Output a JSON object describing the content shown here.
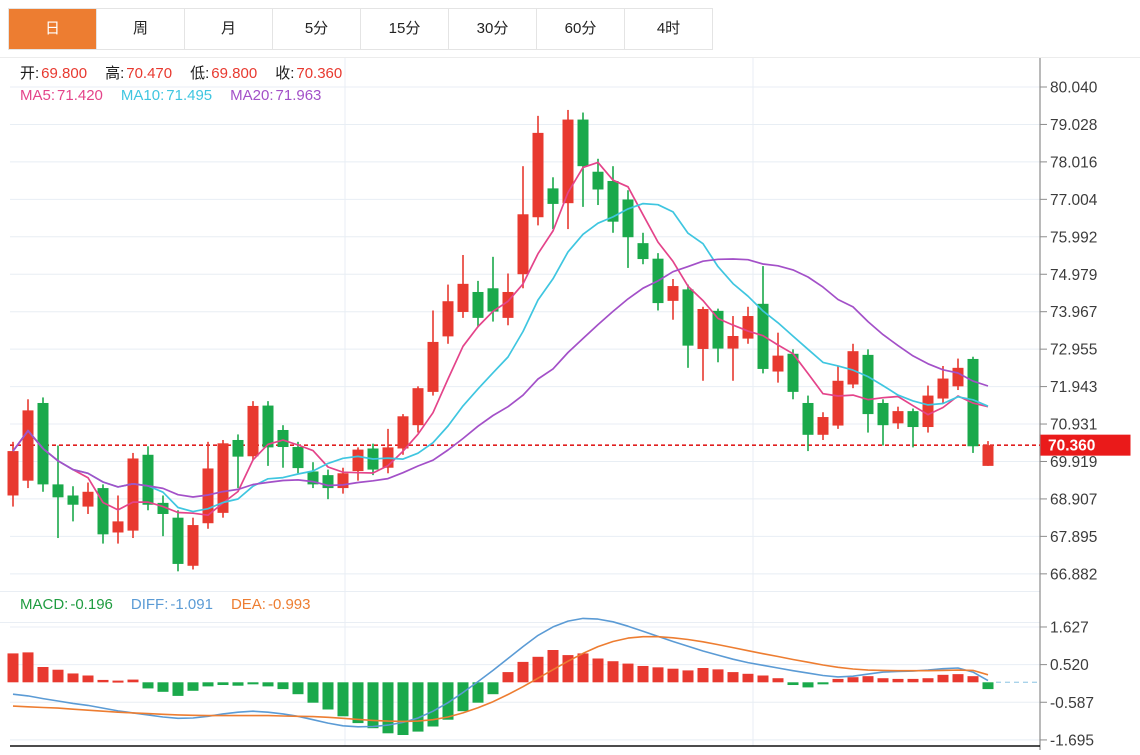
{
  "tabs": {
    "active_color": "#ed7d31",
    "items": [
      {
        "label": "日",
        "name": "day",
        "active": true
      },
      {
        "label": "周",
        "name": "week",
        "active": false
      },
      {
        "label": "月",
        "name": "month",
        "active": false
      },
      {
        "label": "5分",
        "name": "5min",
        "active": false
      },
      {
        "label": "15分",
        "name": "15min",
        "active": false
      },
      {
        "label": "30分",
        "name": "30min",
        "active": false
      },
      {
        "label": "60分",
        "name": "60min",
        "active": false
      },
      {
        "label": "4时",
        "name": "4hour",
        "active": false
      }
    ]
  },
  "info": {
    "ohlc": [
      {
        "label": "开:",
        "value": "69.800",
        "value_color": "#e8392f"
      },
      {
        "label": "高:",
        "value": "70.470",
        "value_color": "#e8392f"
      },
      {
        "label": "低:",
        "value": "69.800",
        "value_color": "#e8392f"
      },
      {
        "label": "收:",
        "value": "70.360",
        "value_color": "#e8392f"
      }
    ],
    "ma": [
      {
        "label": "MA5:",
        "value": "71.420",
        "color": "#e4448a"
      },
      {
        "label": "MA10:",
        "value": "71.495",
        "color": "#3fc6e0"
      },
      {
        "label": "MA20:",
        "value": "71.963",
        "color": "#a350c8"
      }
    ],
    "macd": [
      {
        "label": "MACD:",
        "value": "-0.196",
        "color": "#1f9c40"
      },
      {
        "label": "DIFF:",
        "value": "-1.091",
        "color": "#5b9bd5"
      },
      {
        "label": "DEA:",
        "value": "-0.993",
        "color": "#ed7d31"
      }
    ]
  },
  "chart_data": [
    {
      "type": "candlestick",
      "timeframe": "日",
      "up_color": "#e8392f",
      "down_color": "#1aa94b",
      "grid": true,
      "axis_side": "right",
      "y_ticks": [
        "80.040",
        "79.028",
        "78.016",
        "77.004",
        "75.992",
        "74.979",
        "73.967",
        "72.955",
        "71.943",
        "70.931",
        "69.919",
        "68.907",
        "67.895",
        "66.882"
      ],
      "ylim": [
        66.5,
        80.3
      ],
      "current_price": 70.36,
      "current_price_label": "70.360",
      "current_price_tag_color": "#ea1a1a",
      "overlays": [
        {
          "name": "MA5",
          "period": 5,
          "color": "#e4448a",
          "value_label": "71.420"
        },
        {
          "name": "MA10",
          "period": 10,
          "color": "#3fc6e0",
          "value_label": "71.495"
        },
        {
          "name": "MA20",
          "period": 20,
          "color": "#a350c8",
          "value_label": "71.963"
        }
      ],
      "ohlc_last": {
        "open": 69.8,
        "high": 70.47,
        "low": 69.8,
        "close": 70.36
      },
      "candles": [
        [
          69.0,
          70.45,
          68.7,
          70.2
        ],
        [
          69.4,
          71.6,
          69.2,
          71.3
        ],
        [
          71.5,
          71.65,
          69.1,
          69.3
        ],
        [
          69.3,
          70.35,
          67.85,
          68.95
        ],
        [
          69.0,
          69.25,
          68.3,
          68.75
        ],
        [
          68.7,
          69.35,
          68.5,
          69.1
        ],
        [
          69.2,
          69.3,
          67.7,
          67.95
        ],
        [
          68.0,
          69.0,
          67.7,
          68.3
        ],
        [
          68.05,
          70.15,
          67.85,
          70.0
        ],
        [
          70.1,
          70.33,
          68.6,
          68.75
        ],
        [
          68.8,
          69.0,
          67.9,
          68.5
        ],
        [
          68.4,
          68.6,
          66.95,
          67.15
        ],
        [
          67.1,
          68.4,
          67.0,
          68.2
        ],
        [
          68.25,
          70.45,
          68.1,
          69.73
        ],
        [
          68.53,
          70.5,
          68.4,
          70.41
        ],
        [
          70.5,
          70.65,
          69.2,
          70.05
        ],
        [
          70.06,
          71.55,
          69.95,
          71.42
        ],
        [
          71.43,
          71.55,
          69.8,
          70.3
        ],
        [
          70.77,
          70.9,
          69.75,
          70.31
        ],
        [
          70.31,
          70.45,
          69.6,
          69.74
        ],
        [
          69.65,
          69.9,
          69.2,
          69.3
        ],
        [
          69.55,
          69.7,
          68.9,
          69.2
        ],
        [
          69.2,
          69.75,
          69.05,
          69.6
        ],
        [
          69.66,
          70.3,
          69.4,
          70.24
        ],
        [
          70.27,
          70.4,
          69.55,
          69.7
        ],
        [
          69.75,
          70.8,
          69.6,
          70.3
        ],
        [
          70.27,
          71.2,
          70.1,
          71.14
        ],
        [
          70.9,
          71.95,
          70.7,
          71.9
        ],
        [
          71.8,
          74.0,
          71.7,
          73.15
        ],
        [
          73.3,
          74.7,
          73.1,
          74.25
        ],
        [
          73.96,
          75.5,
          73.8,
          74.72
        ],
        [
          74.5,
          74.8,
          73.55,
          73.8
        ],
        [
          74.6,
          75.45,
          73.7,
          73.97
        ],
        [
          73.8,
          75.0,
          73.6,
          74.5
        ],
        [
          74.98,
          77.9,
          74.6,
          76.6
        ],
        [
          76.52,
          79.26,
          76.3,
          78.8
        ],
        [
          77.3,
          77.6,
          76.2,
          76.88
        ],
        [
          76.9,
          79.42,
          76.2,
          79.16
        ],
        [
          79.16,
          79.35,
          76.8,
          77.9
        ],
        [
          77.75,
          78.1,
          76.85,
          77.27
        ],
        [
          77.5,
          77.9,
          76.1,
          76.4
        ],
        [
          77.0,
          77.25,
          75.15,
          75.98
        ],
        [
          75.82,
          76.1,
          75.25,
          75.39
        ],
        [
          75.4,
          75.55,
          74.0,
          74.2
        ],
        [
          74.26,
          74.85,
          73.75,
          74.66
        ],
        [
          74.57,
          74.7,
          72.45,
          73.05
        ],
        [
          72.96,
          74.1,
          72.1,
          74.04
        ],
        [
          73.99,
          74.05,
          72.6,
          72.97
        ],
        [
          72.97,
          73.85,
          72.1,
          73.31
        ],
        [
          73.24,
          74.1,
          73.1,
          73.85
        ],
        [
          74.18,
          75.2,
          72.3,
          72.42
        ],
        [
          72.35,
          73.4,
          72.05,
          72.78
        ],
        [
          72.83,
          72.95,
          71.6,
          71.8
        ],
        [
          71.5,
          71.7,
          70.2,
          70.64
        ],
        [
          70.64,
          71.25,
          70.5,
          71.12
        ],
        [
          70.89,
          72.5,
          70.8,
          72.1
        ],
        [
          72.0,
          73.1,
          71.9,
          72.9
        ],
        [
          72.8,
          72.95,
          70.7,
          71.2
        ],
        [
          71.5,
          71.6,
          70.35,
          70.9
        ],
        [
          70.95,
          71.4,
          70.8,
          71.28
        ],
        [
          71.28,
          71.35,
          70.3,
          70.85
        ],
        [
          70.85,
          71.97,
          70.7,
          71.7
        ],
        [
          71.62,
          72.5,
          71.5,
          72.16
        ],
        [
          71.95,
          72.7,
          71.85,
          72.45
        ],
        [
          72.69,
          72.75,
          70.15,
          70.33
        ],
        [
          69.8,
          70.47,
          69.8,
          70.36
        ]
      ]
    },
    {
      "type": "bar",
      "name": "MACD",
      "y_ticks": [
        "1.627",
        "0.520",
        "-0.587",
        "-1.695"
      ],
      "ylim": [
        -1.9,
        1.95
      ],
      "hist_up_color": "#e8392f",
      "hist_down_color": "#1aa94b",
      "diff_color": "#5b9bd5",
      "dea_color": "#ed7d31",
      "values_displayed": {
        "macd": "-0.196",
        "diff": "-1.091",
        "dea": "-0.993"
      },
      "histogram": [
        0.85,
        0.88,
        0.45,
        0.37,
        0.26,
        0.2,
        0.07,
        0.05,
        0.08,
        -0.18,
        -0.28,
        -0.4,
        -0.25,
        -0.12,
        -0.08,
        -0.1,
        -0.06,
        -0.12,
        -0.2,
        -0.35,
        -0.6,
        -0.8,
        -1.0,
        -1.2,
        -1.35,
        -1.5,
        -1.55,
        -1.45,
        -1.3,
        -1.1,
        -0.85,
        -0.6,
        -0.35,
        0.3,
        0.6,
        0.75,
        0.95,
        0.8,
        0.85,
        0.7,
        0.62,
        0.55,
        0.48,
        0.44,
        0.4,
        0.35,
        0.42,
        0.38,
        0.3,
        0.25,
        0.2,
        0.12,
        -0.08,
        -0.15,
        -0.06,
        0.1,
        0.15,
        0.18,
        0.12,
        0.1,
        0.1,
        0.12,
        0.22,
        0.24,
        0.18,
        -0.2
      ],
      "diff": [
        -0.35,
        -0.4,
        -0.48,
        -0.55,
        -0.62,
        -0.68,
        -0.76,
        -0.84,
        -0.9,
        -0.96,
        -1.02,
        -1.06,
        -1.05,
        -1.0,
        -0.93,
        -0.88,
        -0.85,
        -0.88,
        -0.93,
        -1.0,
        -1.1,
        -1.2,
        -1.28,
        -1.31,
        -1.3,
        -1.26,
        -1.18,
        -1.05,
        -0.85,
        -0.6,
        -0.3,
        0.02,
        0.35,
        0.7,
        1.05,
        1.38,
        1.63,
        1.8,
        1.88,
        1.86,
        1.78,
        1.65,
        1.5,
        1.35,
        1.2,
        1.06,
        0.92,
        0.8,
        0.68,
        0.58,
        0.5,
        0.42,
        0.34,
        0.27,
        0.2,
        0.16,
        0.18,
        0.24,
        0.3,
        0.32,
        0.33,
        0.36,
        0.4,
        0.42,
        0.3,
        0.05
      ],
      "dea": [
        -0.7,
        -0.72,
        -0.74,
        -0.76,
        -0.79,
        -0.82,
        -0.85,
        -0.88,
        -0.9,
        -0.92,
        -0.94,
        -0.96,
        -0.97,
        -0.98,
        -0.98,
        -0.98,
        -0.98,
        -0.98,
        -0.99,
        -1.0,
        -1.01,
        -1.03,
        -1.06,
        -1.09,
        -1.12,
        -1.14,
        -1.15,
        -1.14,
        -1.1,
        -1.02,
        -0.9,
        -0.75,
        -0.57,
        -0.36,
        -0.13,
        0.12,
        0.37,
        0.62,
        0.85,
        1.05,
        1.2,
        1.3,
        1.34,
        1.34,
        1.31,
        1.26,
        1.19,
        1.11,
        1.02,
        0.93,
        0.84,
        0.76,
        0.67,
        0.59,
        0.51,
        0.44,
        0.39,
        0.36,
        0.35,
        0.34,
        0.34,
        0.34,
        0.35,
        0.36,
        0.35,
        0.22
      ]
    }
  ]
}
